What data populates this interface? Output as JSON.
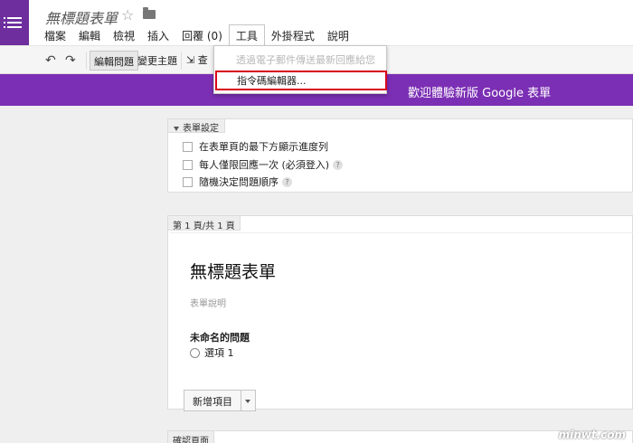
{
  "header": {
    "title": "無標題表單",
    "menu": [
      "檔案",
      "編輯",
      "檢視",
      "插入",
      "回覆 (0)",
      "工具",
      "外掛程式",
      "說明"
    ]
  },
  "toolbar": {
    "edit_label": "編輯問題",
    "theme_label": "變更主題",
    "view_label": "查"
  },
  "banner": {
    "text": "歡迎體驗新版 Google 表單"
  },
  "tools_menu": {
    "items": [
      "透過電子郵件傳送最新回應給您",
      "指令碼編輯器..."
    ]
  },
  "settings": {
    "title": "表單設定",
    "options": [
      "在表單頁的最下方顯示進度列",
      "每人僅限回應一次 (必須登入)",
      "隨機決定問題順序"
    ]
  },
  "page": {
    "label": "第 1 頁/共 1 頁",
    "form_title": "無標題表單",
    "description_placeholder": "表單說明",
    "question_title": "未命名的問題",
    "choice_label": "選項 1",
    "add_item_label": "新增項目"
  },
  "confirmation": {
    "label": "確認頁面"
  },
  "watermark": "minwt.com"
}
